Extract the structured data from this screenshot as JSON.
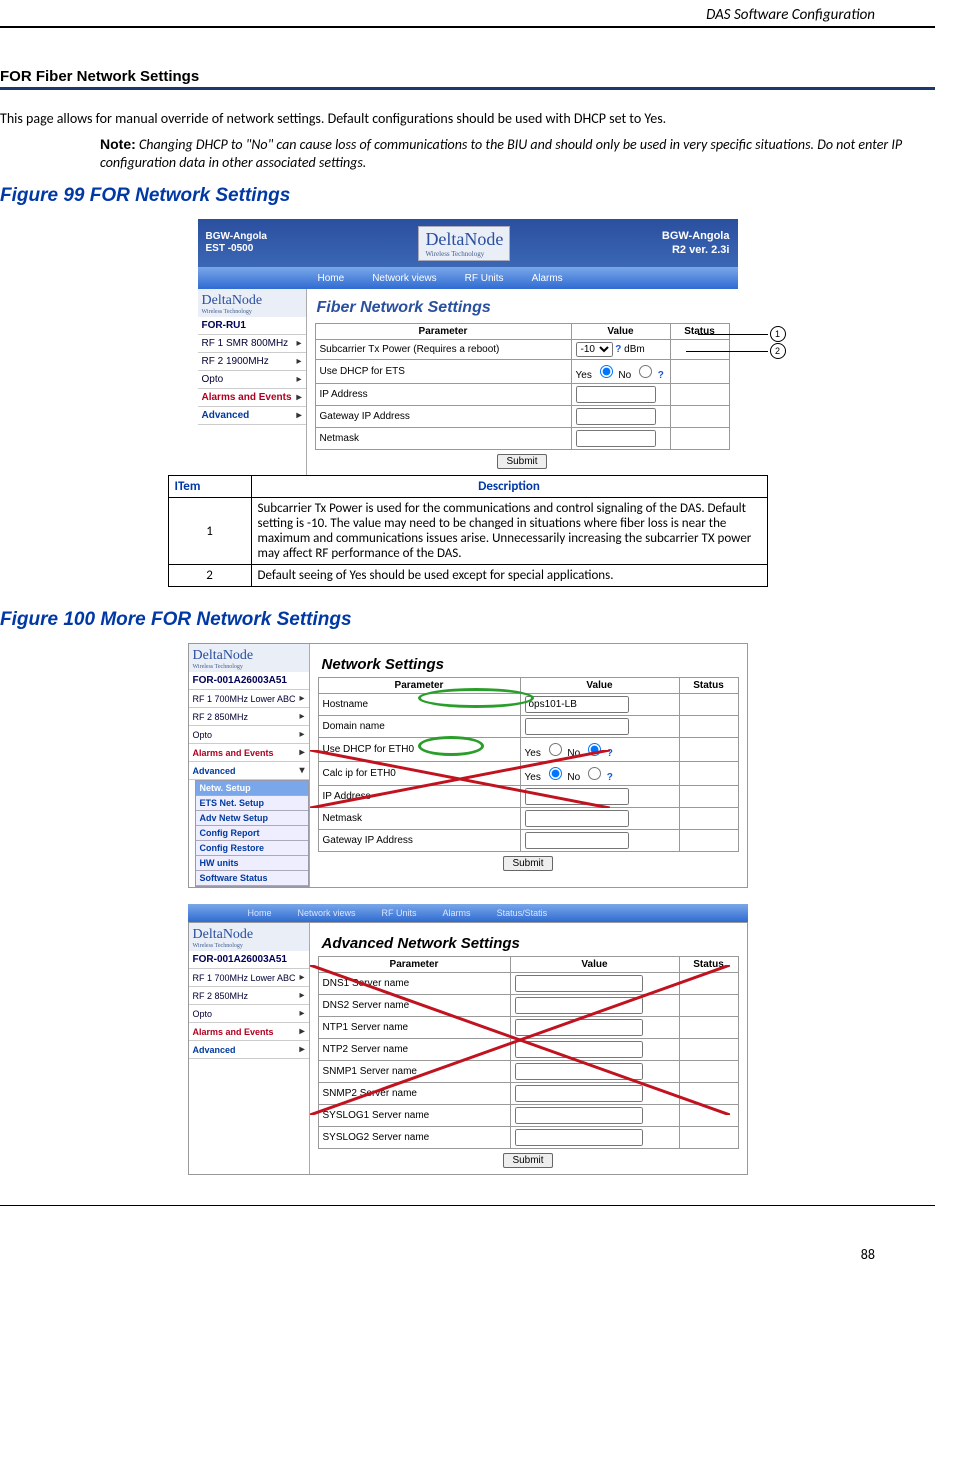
{
  "header": {
    "right": "DAS Software Configuration"
  },
  "section_title": "FOR Fiber Network Settings",
  "intro": "This page allows for manual override of network settings. Default configurations should be used with DHCP set to Yes.",
  "note_label": "Note:",
  "note_text": "Changing DHCP to \"No\" can cause loss of communications to the BIU and should only be used in very specific situations. Do not enter IP configuration data in other associated settings.",
  "fig99": "Figure 99    FOR Network Settings",
  "fig100": "Figure 100    More FOR Network Settings",
  "page_number": "88",
  "shot1": {
    "top_left": "BGW-Angola\nEST -0500",
    "top_right_line1": "BGW-Angola",
    "top_right_line2": "R2 ver. 2.3i",
    "logo": "DeltaNode",
    "logo_sub": "Wireless  Technology",
    "tabs": [
      "Home",
      "Network views",
      "RF Units",
      "Alarms"
    ],
    "side_head": "FOR-RU1",
    "side_items": [
      {
        "label": "RF 1 SMR 800MHz"
      },
      {
        "label": "RF 2 1900MHz"
      },
      {
        "label": "Opto"
      },
      {
        "label": "Alarms and Events",
        "class": "alarms"
      },
      {
        "label": "Advanced",
        "class": "adv"
      }
    ],
    "panel_title": "Fiber Network Settings",
    "cols": [
      "Parameter",
      "Value",
      "Status"
    ],
    "rows": [
      {
        "p": "Subcarrier Tx Power (Requires a reboot)",
        "v": "-10",
        "suffix": "dBm",
        "type": "select"
      },
      {
        "p": "Use DHCP for ETS",
        "v": "Yes",
        "type": "yesno"
      },
      {
        "p": "IP Address",
        "v": "",
        "type": "text"
      },
      {
        "p": "Gateway IP Address",
        "v": "",
        "type": "text"
      },
      {
        "p": "Netmask",
        "v": "",
        "type": "text"
      }
    ],
    "submit": "Submit",
    "callouts": {
      "c1": "1",
      "c2": "2"
    }
  },
  "desc_table": {
    "h1": "ITem",
    "h2": "Description",
    "rows": [
      {
        "n": "1",
        "d": "Subcarrier Tx Power is used for the communications and control signaling of the DAS.  Default setting is -10.  The value may need to be changed in situations where fiber loss is near the maximum and communications issues arise.  Unnecessarily increasing the subcarrier TX power may affect RF performance of the DAS."
      },
      {
        "n": "2",
        "d": "Default seeing of Yes should be used except for special applications."
      }
    ]
  },
  "shot2": {
    "logo": "DeltaNode",
    "logo_sub": "Wireless  Technology",
    "side_head": "FOR-001A26003A51",
    "side_items": [
      {
        "label": "RF 1 700MHz Lower ABC"
      },
      {
        "label": "RF 2 850MHz"
      },
      {
        "label": "Opto"
      },
      {
        "label": "Alarms and Events",
        "class": "alarms"
      },
      {
        "label": "Advanced",
        "class": "adv"
      }
    ],
    "adv_items": [
      "Netw. Setup",
      "ETS Net. Setup",
      "Adv Netw Setup",
      "Config Report",
      "Config Restore",
      "HW units",
      "Software Status"
    ],
    "panel_title": "Network Settings",
    "cols": [
      "Parameter",
      "Value",
      "Status"
    ],
    "rows": [
      {
        "p": "Hostname",
        "v": "ops101-LB"
      },
      {
        "p": "Domain name",
        "v": ""
      },
      {
        "p": "Use DHCP for ETH0",
        "v": "Yes/No",
        "type": "yesno_no"
      },
      {
        "p": "Calc ip for ETH0",
        "v": "Yes/No",
        "type": "yesno_yes"
      },
      {
        "p": "IP Address",
        "v": ""
      },
      {
        "p": "Netmask",
        "v": ""
      },
      {
        "p": "Gateway IP Address",
        "v": ""
      }
    ],
    "submit": "Submit"
  },
  "shot3": {
    "tabs": [
      "Home",
      "Network views",
      "RF Units",
      "Alarms",
      "Status/Statis"
    ],
    "logo": "DeltaNode",
    "logo_sub": "Wireless  Technology",
    "side_head": "FOR-001A26003A51",
    "side_items": [
      {
        "label": "RF 1 700MHz Lower ABC"
      },
      {
        "label": "RF 2 850MHz"
      },
      {
        "label": "Opto"
      },
      {
        "label": "Alarms and Events",
        "class": "alarms"
      },
      {
        "label": "Advanced",
        "class": "adv"
      }
    ],
    "panel_title": "Advanced Network Settings",
    "cols": [
      "Parameter",
      "Value",
      "Status"
    ],
    "rows": [
      {
        "p": "DNS1 Server name"
      },
      {
        "p": "DNS2 Server name"
      },
      {
        "p": "NTP1 Server name"
      },
      {
        "p": "NTP2 Server name"
      },
      {
        "p": "SNMP1 Server name"
      },
      {
        "p": "SNMP2 Server name"
      },
      {
        "p": "SYSLOG1 Server name"
      },
      {
        "p": "SYSLOG2 Server name"
      }
    ],
    "submit": "Submit"
  }
}
